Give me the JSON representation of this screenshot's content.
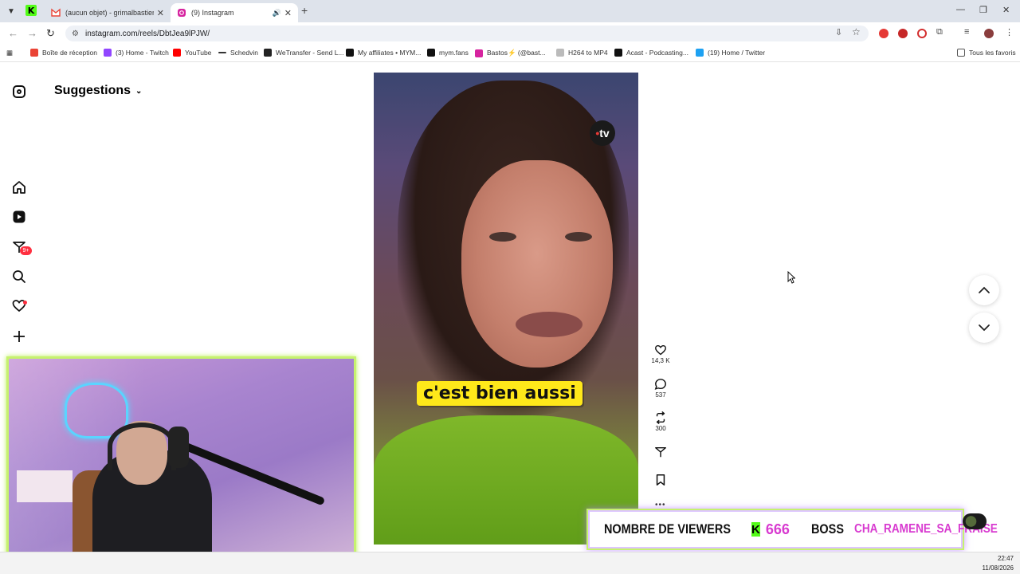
{
  "browser": {
    "tabs": [
      {
        "title": "(aucun objet) - grimalbastien@",
        "active": false
      },
      {
        "title": "(9) Instagram",
        "active": true
      }
    ],
    "url": "instagram.com/reels/DbtJea9lPJW/",
    "bookmarks": [
      "Boîte de réception",
      "(3) Home - Twitch",
      "YouTube",
      "Schedvin",
      "WeTransfer - Send L...",
      "My affiliates • MYM...",
      "mym.fans",
      "Bastos⚡ (@bast...",
      "H264 to MP4",
      "Acast - Podcasting...",
      "(19) Home / Twitter"
    ],
    "all_bookmarks": "Tous les favoris"
  },
  "instagram": {
    "header": "Suggestions",
    "notification_badge": "9+",
    "reel": {
      "caption": "c'est bien aussi",
      "channel_logo": "tv"
    },
    "actions": {
      "likes": "14,3 K",
      "comments": "537",
      "reposts": "300"
    }
  },
  "stream": {
    "viewers_label": "NOMBRE DE VIEWERS",
    "viewers_k": "K",
    "viewers_count": "666",
    "boss_label": "BOSS",
    "boss_name": "CHA_RAMENE_SA_FRAISE"
  },
  "taskbar": {
    "time": "22:47",
    "date": "11/08/2026"
  },
  "colors": {
    "accent_green": "#53fc18",
    "overlay_pink": "#d83bd0",
    "caption_yellow": "#ffe81a",
    "badge_red": "#ff3040"
  }
}
